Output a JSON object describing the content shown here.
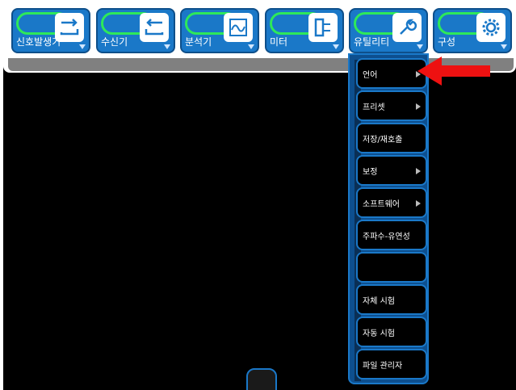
{
  "tabs": [
    {
      "label": "신호발생기",
      "icon": "signal-generator-icon"
    },
    {
      "label": "수신기",
      "icon": "receiver-icon"
    },
    {
      "label": "분석기",
      "icon": "analyzer-icon"
    },
    {
      "label": "미터",
      "icon": "meter-icon"
    },
    {
      "label": "유틸리티",
      "icon": "wrench-icon"
    },
    {
      "label": "구성",
      "icon": "gear-icon"
    }
  ],
  "menu": {
    "items": [
      {
        "label": "언어",
        "submenu": true
      },
      {
        "label": "프리셋",
        "submenu": true
      },
      {
        "label": "저장/재호출",
        "submenu": false
      },
      {
        "label": "보정",
        "submenu": true
      },
      {
        "label": "소프트웨어",
        "submenu": true
      },
      {
        "label": "주파수-유연성",
        "submenu": false
      },
      {
        "label": "",
        "submenu": false
      },
      {
        "label": "자체 시험",
        "submenu": false
      },
      {
        "label": "자동 시험",
        "submenu": false
      },
      {
        "label": "파일 관리자",
        "submenu": false
      }
    ]
  },
  "colors": {
    "accent": "#1a78c8",
    "pill": "#2ee85a",
    "annotation_arrow": "#ee1111"
  }
}
